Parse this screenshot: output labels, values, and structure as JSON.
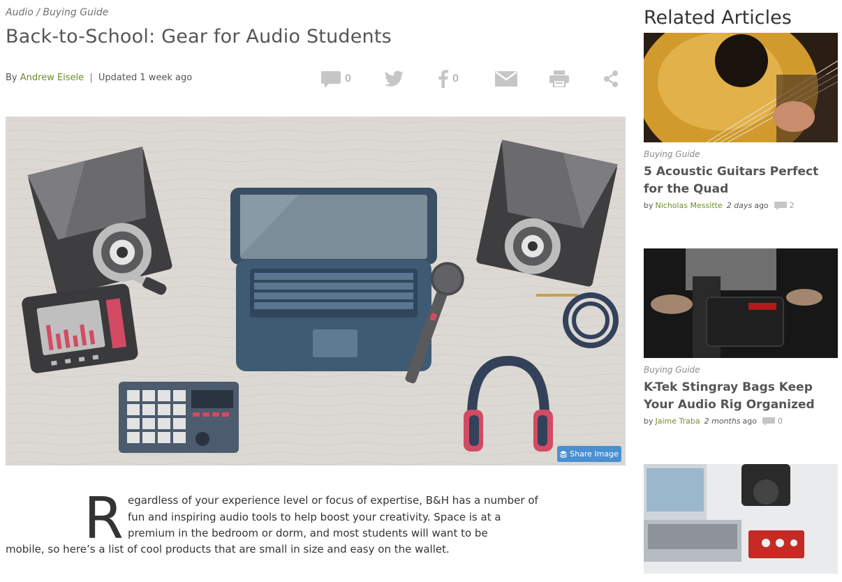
{
  "article": {
    "breadcrumb": "Audio / Buying Guide",
    "title": "Back-to-School: Gear for Audio Students",
    "byline_prefix": "By",
    "author": "Andrew Eisele",
    "separator": "|",
    "updated": "Updated 1 week ago",
    "share": {
      "comments_icon": "comment-icon",
      "comments_count": "0",
      "twitter_icon": "twitter-icon",
      "facebook_icon": "facebook-icon",
      "facebook_count": "0",
      "email_icon": "email-icon",
      "print_icon": "print-icon",
      "share_icon": "share-icon"
    },
    "share_image_label": "Share Image",
    "dropcap": "R",
    "lead_first_lines": "egardless of your experience level or focus of expertise, B&H has a number of fun and inspiring audio tools to help boost your creativity. Space is at a premium in the bedroom or dorm, and most students will want to be",
    "lead_rest": "mobile, so here’s a list of cool products that are small in size and easy on the wallet."
  },
  "sidebar": {
    "heading": "Related Articles",
    "cards": [
      {
        "category": "Buying Guide",
        "title": "5 Acoustic Guitars Perfect for the Quad",
        "by": "by",
        "author": "Nicholas Messitte",
        "ago": "2 days",
        "ago_word": "ago",
        "comments": "2"
      },
      {
        "category": "Buying Guide",
        "title": "K-Tek Stingray Bags Keep Your Audio Rig Organized",
        "by": "by",
        "author": "Jaime Traba",
        "ago": "2 months",
        "ago_word": "ago",
        "comments": "0"
      },
      {
        "category": "",
        "title": "",
        "by": "",
        "author": "",
        "ago": "",
        "ago_word": "",
        "comments": ""
      }
    ]
  },
  "colors": {
    "author_link": "#6a8e2c",
    "share_button": "#4a90d0",
    "icon_gray": "#c6c6c6"
  }
}
